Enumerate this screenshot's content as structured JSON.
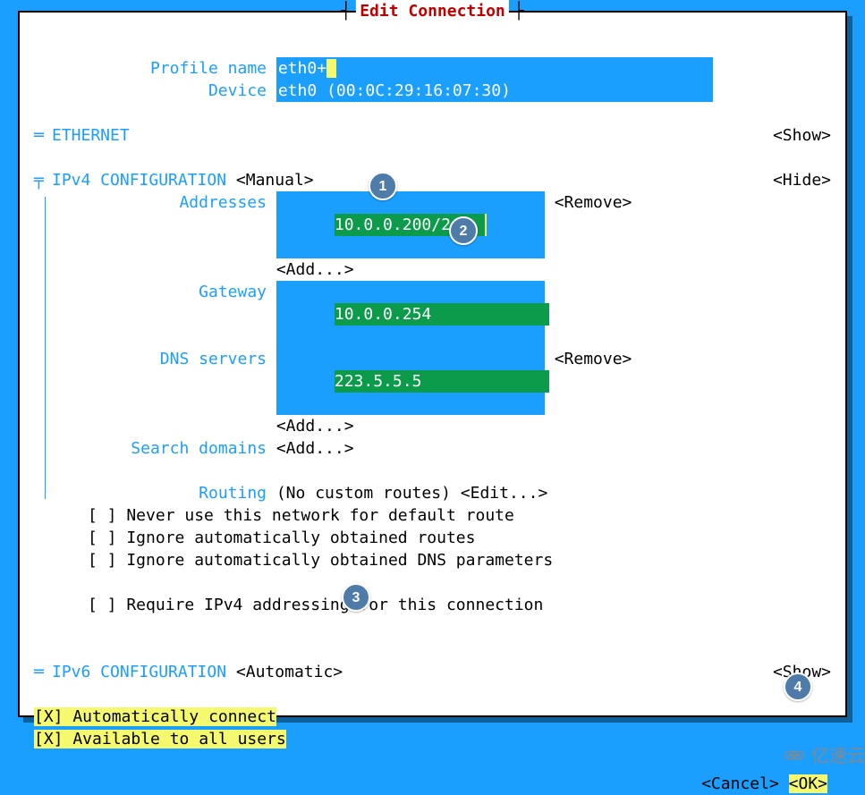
{
  "title": "Edit Connection",
  "profile": {
    "name_label": "Profile name",
    "name_value": "eth0+",
    "device_label": "Device",
    "device_value": "eth0 (00:0C:29:16:07:30)"
  },
  "ethernet": {
    "section": "ETHERNET",
    "toggle": "<Show>"
  },
  "ipv4": {
    "section": "IPv4 CONFIGURATION",
    "mode": "<Manual>",
    "toggle": "<Hide>",
    "addresses_label": "Addresses",
    "addresses_value": "10.0.0.200/24",
    "addresses_remove": "<Remove>",
    "add": "<Add...>",
    "gateway_label": "Gateway",
    "gateway_value": "10.0.0.254",
    "dns_label": "DNS servers",
    "dns_value": "223.5.5.5",
    "dns_remove": "<Remove>",
    "search_label": "Search domains",
    "routing_label": "Routing",
    "routing_value": "(No custom routes)",
    "routing_edit": "<Edit...>",
    "cb1": "[ ] Never use this network for default route",
    "cb2": "[ ] Ignore automatically obtained routes",
    "cb3": "[ ] Ignore automatically obtained DNS parameters",
    "cb4": "[ ] Require IPv4 addressing for this connection"
  },
  "ipv6": {
    "section": "IPv6 CONFIGURATION",
    "mode": "<Automatic>",
    "toggle": "<Show>"
  },
  "connection": {
    "auto": "[X] Automatically connect",
    "all_users": "[X] Available to all users"
  },
  "actions": {
    "cancel": "<Cancel>",
    "ok": "<OK>"
  },
  "callouts": [
    "1",
    "2",
    "3",
    "4"
  ],
  "watermark": "亿速云"
}
